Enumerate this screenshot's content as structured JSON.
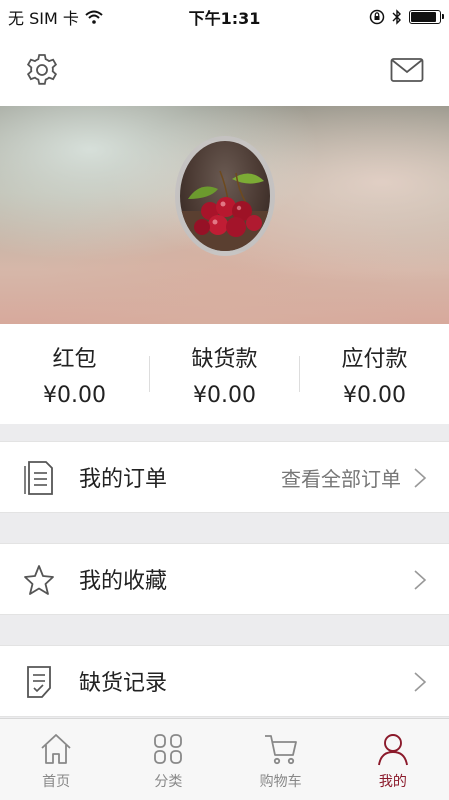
{
  "status_bar": {
    "carrier": "无 SIM 卡",
    "time": "下午1:31"
  },
  "nav": {
    "settings_icon": "gear-icon",
    "messages_icon": "envelope-icon"
  },
  "stats": [
    {
      "label": "红包",
      "value": "¥0.00"
    },
    {
      "label": "缺货款",
      "value": "¥0.00"
    },
    {
      "label": "应付款",
      "value": "¥0.00"
    }
  ],
  "menu": {
    "orders": {
      "label": "我的订单",
      "hint": "查看全部订单"
    },
    "favorites": {
      "label": "我的收藏"
    },
    "shortage": {
      "label": "缺货记录"
    }
  },
  "tabs": [
    {
      "label": "首页",
      "icon": "home-icon"
    },
    {
      "label": "分类",
      "icon": "category-icon"
    },
    {
      "label": "购物车",
      "icon": "cart-icon"
    },
    {
      "label": "我的",
      "icon": "user-icon"
    }
  ],
  "colors": {
    "accent": "#8b1a2b",
    "background": "#ececee",
    "surface": "#ffffff"
  }
}
